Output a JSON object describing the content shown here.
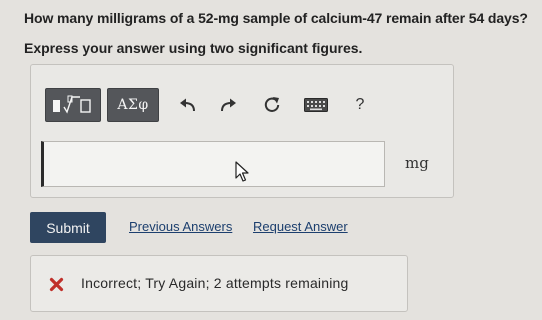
{
  "question": {
    "text": "How many milligrams of a 52-mg sample of calcium-47 remain after 54 days?",
    "instruction": "Express your answer using two significant figures."
  },
  "toolbar": {
    "templates_icon": "templates-sqrt-icon",
    "symbols_label": "ΑΣφ",
    "undo_icon": "undo-arrow-icon",
    "redo_icon": "redo-arrow-icon",
    "reset_icon": "reset-icon",
    "keyboard_icon": "keyboard-icon",
    "help_label": "?"
  },
  "answer": {
    "value": "",
    "placeholder": "",
    "unit": "mg"
  },
  "actions": {
    "submit_label": "Submit",
    "previous_answers_label": "Previous Answers",
    "request_answer_label": "Request Answer"
  },
  "feedback": {
    "icon": "x-mark-icon",
    "text": "Incorrect; Try Again; 2 attempts remaining"
  },
  "colors": {
    "background": "#e4e2de",
    "submit_bg": "#2f4560",
    "toolbar_button_bg": "#54565a",
    "link": "#1c3f6e",
    "error": "#c0302a"
  }
}
